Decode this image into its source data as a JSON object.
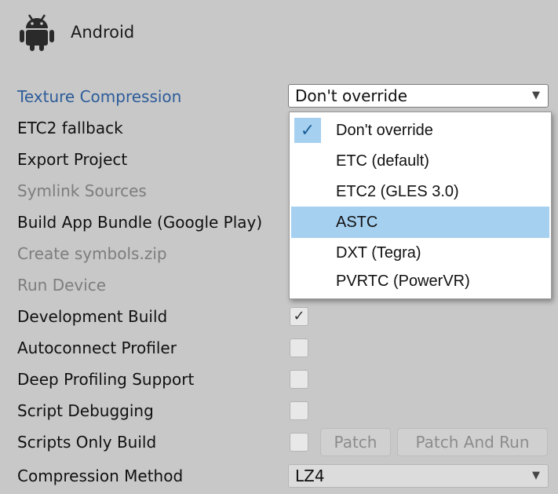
{
  "header": {
    "title": "Android",
    "icon": "android-icon"
  },
  "settings": {
    "texture_compression": {
      "label": "Texture Compression",
      "value": "Don't override"
    },
    "etc2_fallback": {
      "label": "ETC2 fallback"
    },
    "export_project": {
      "label": "Export Project"
    },
    "symlink_sources": {
      "label": "Symlink Sources"
    },
    "build_app_bundle": {
      "label": "Build App Bundle (Google Play)"
    },
    "create_symbols": {
      "label": "Create symbols.zip"
    },
    "run_device": {
      "label": "Run Device"
    },
    "development_build": {
      "label": "Development Build",
      "checked": true
    },
    "autoconnect_profiler": {
      "label": "Autoconnect Profiler",
      "checked": false
    },
    "deep_profiling": {
      "label": "Deep Profiling Support",
      "checked": false
    },
    "script_debugging": {
      "label": "Script Debugging",
      "checked": false
    },
    "scripts_only_build": {
      "label": "Scripts Only Build",
      "checked": false
    },
    "compression_method": {
      "label": "Compression Method",
      "value": "LZ4"
    }
  },
  "buttons": {
    "patch": "Patch",
    "patch_and_run": "Patch And Run"
  },
  "symbols": {
    "checkmark": "✓",
    "dropdown_arrow": "▼"
  },
  "menu": {
    "items": [
      {
        "label": "Don't override",
        "selected": true
      },
      {
        "label": "ETC (default)"
      },
      {
        "label": "ETC2 (GLES 3.0)"
      },
      {
        "label": "ASTC",
        "hovered": true
      },
      {
        "label": "DXT (Tegra)"
      },
      {
        "label": "PVRTC (PowerVR)"
      }
    ]
  },
  "colors": {
    "background": "#c8c8c8",
    "link": "#2c5c9a",
    "highlight": "#a6d0f0",
    "disabled": "#7d7d7d"
  }
}
